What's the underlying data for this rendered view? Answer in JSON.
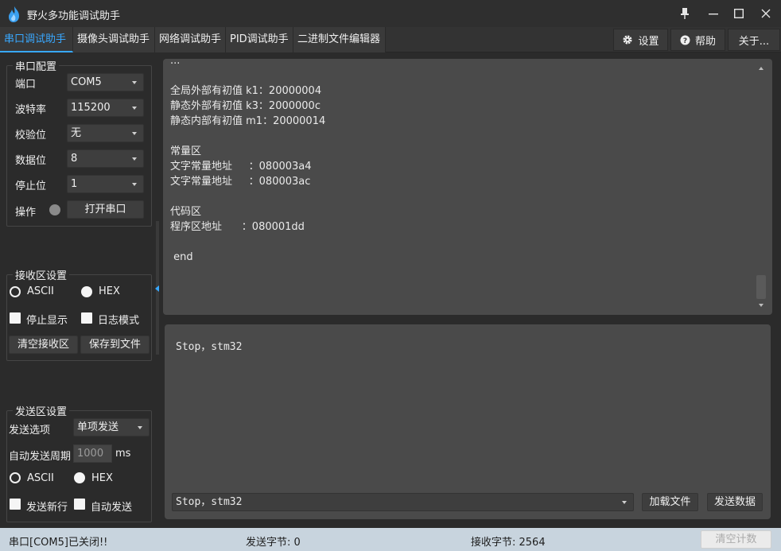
{
  "app": {
    "title": "野火多功能调试助手"
  },
  "tabs": [
    {
      "label": "串口调试助手",
      "active": true
    },
    {
      "label": "摄像头调试助手",
      "active": false
    },
    {
      "label": "网络调试助手",
      "active": false
    },
    {
      "label": "PID调试助手",
      "active": false
    },
    {
      "label": "二进制文件编辑器",
      "active": false
    }
  ],
  "topbar": {
    "settings_label": "设置",
    "help_label": "帮助",
    "about_label": "关于..."
  },
  "serial_config": {
    "title": "串口配置",
    "port_label": "端口",
    "port_value": "COM5",
    "baud_label": "波特率",
    "baud_value": "115200",
    "parity_label": "校验位",
    "parity_value": "无",
    "databits_label": "数据位",
    "databits_value": "8",
    "stopbits_label": "停止位",
    "stopbits_value": "1",
    "op_label": "操作",
    "open_button": "打开串口"
  },
  "receive_settings": {
    "title": "接收区设置",
    "ascii_label": "ASCII",
    "hex_label": "HEX",
    "stop_display_label": "停止显示",
    "log_mode_label": "日志模式",
    "clear_button": "清空接收区",
    "save_button": "保存到文件",
    "selected_mode": "HEX"
  },
  "send_settings": {
    "title": "发送区设置",
    "option_label": "发送选项",
    "option_value": "单项发送",
    "period_label": "自动发送周期",
    "period_value": "1000",
    "period_unit": "ms",
    "ascii_label": "ASCII",
    "hex_label": "HEX",
    "newline_label": "发送新行",
    "auto_send_label": "自动发送",
    "selected_mode": "HEX"
  },
  "receive_area": {
    "lines": [
      "...",
      "",
      "全局外部有初值 k1：20000004",
      "静态外部有初值 k3：2000000c",
      "静态内部有初值 m1：20000014",
      "",
      "常量区",
      "文字常量地址     ：080003a4",
      "文字常量地址     ：080003ac",
      "",
      "代码区",
      "程序区地址      ：080001dd",
      "",
      " end"
    ]
  },
  "send_area": {
    "text": "Stop，stm32",
    "input_value": "Stop，stm32",
    "load_file_button": "加载文件",
    "send_button": "发送数据"
  },
  "status": {
    "port_status": "串口[COM5]已关闭!!",
    "sent_bytes_label": "发送字节: 0",
    "received_bytes_label": "接收字节: 2564",
    "clear_count_button": "清空计数"
  },
  "colors": {
    "accent": "#38a8ff",
    "status_bar": "#c8d4de",
    "panel": "#4a4a4a"
  }
}
